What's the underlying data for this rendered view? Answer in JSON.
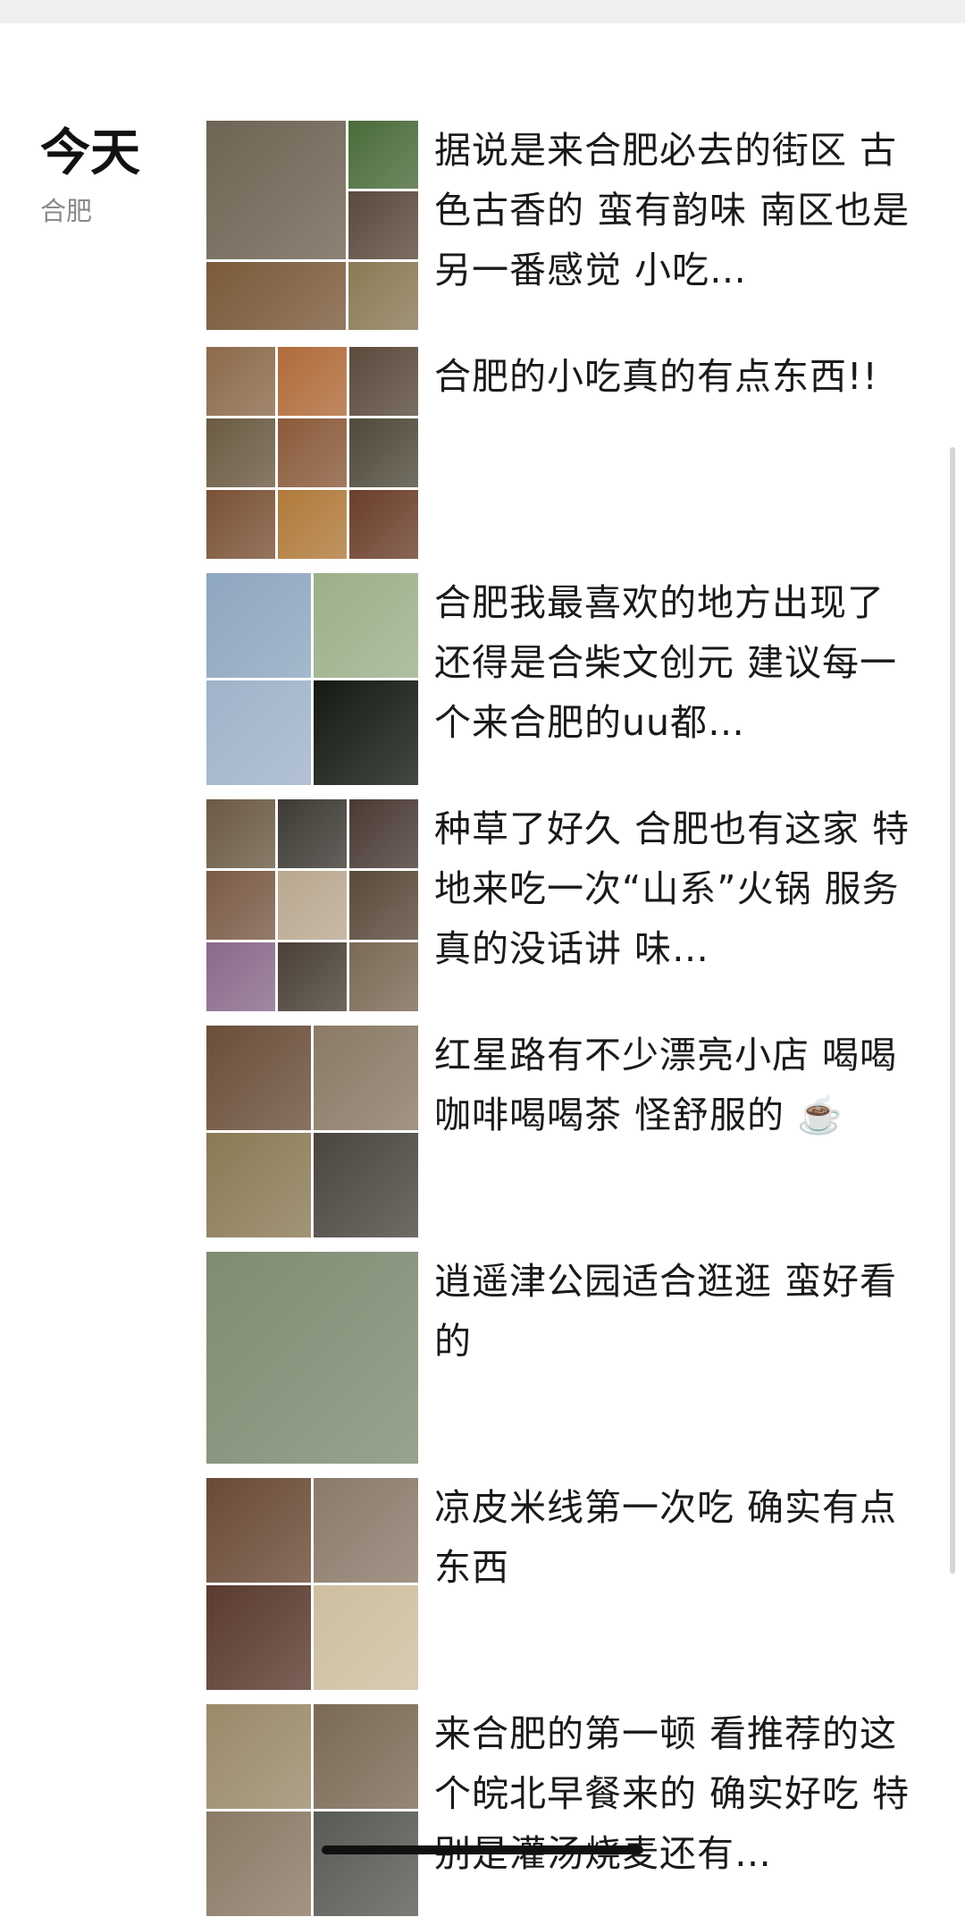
{
  "date_header": {
    "title": "今天",
    "location": "合肥"
  },
  "posts": [
    {
      "text": "据说是来合肥必去的街区 古色古香的 蛮有韵味 南区也是另一番感觉 小吃…",
      "layout": "gbig",
      "colors": [
        "#6f6453",
        "#4a6b3a",
        "#5b4a3d",
        "#7a5a3a",
        "#8a7a55",
        "#5a4f45"
      ]
    },
    {
      "text": "合肥的小吃真的有点东西!!",
      "layout": "g9",
      "colors": [
        "#8c6a4a",
        "#b06b3a",
        "#5a4a3c",
        "#6a5a42",
        "#8a5a3a",
        "#4f4a3a",
        "#7a5236",
        "#b07a3a",
        "#6b3f2a"
      ]
    },
    {
      "text": "合肥我最喜欢的地方出现了 还得是合柴文创元 建议每一个来合肥的uu都…",
      "layout": "g4",
      "colors": [
        "#8ea6bf",
        "#9bb08a",
        "#9fb3c9",
        "#151a14"
      ]
    },
    {
      "text": "种草了好久 合肥也有这家 特地来吃一次“山系”火锅 服务真的没话讲 味…",
      "layout": "g9",
      "colors": [
        "#6b5a44",
        "#3e3a34",
        "#4a3a34",
        "#7a5a46",
        "#b9a890",
        "#5a4a3a",
        "#8a6a8a",
        "#4a4036",
        "#7a6a55"
      ]
    },
    {
      "text": "红星路有不少漂亮小店 喝喝咖啡喝喝茶 怪舒服的 ☕️",
      "layout": "g4",
      "colors": [
        "#6a4f3a",
        "#8a7a66",
        "#8a7a55",
        "#4a463f"
      ]
    },
    {
      "text": "逍遥津公园适合逛逛 蛮好看的",
      "layout": "g1",
      "colors": [
        "#7d8c72"
      ]
    },
    {
      "text": "凉皮米线第一次吃 确实有点东西",
      "layout": "g4",
      "colors": [
        "#6a4a36",
        "#8a7a6a",
        "#5a3a2e",
        "#cdbf9f"
      ]
    },
    {
      "text": "来合肥的第一顿 看推荐的这个皖北早餐来的 确实好吃 特别是灌汤烧麦还有…",
      "layout": "g4",
      "colors": [
        "#9a8a6a",
        "#7a6a55",
        "#8a7a66",
        "#5a5a55"
      ]
    }
  ]
}
